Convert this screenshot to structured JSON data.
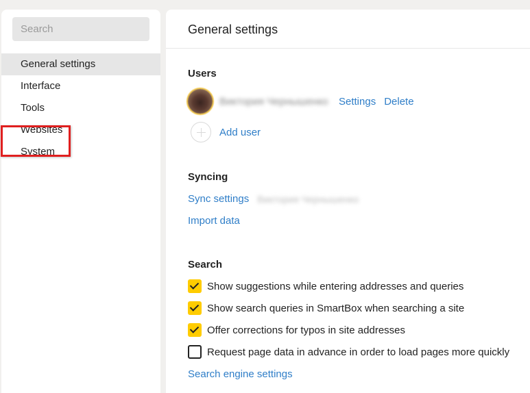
{
  "sidebar": {
    "search_placeholder": "Search",
    "items": [
      {
        "label": "General settings",
        "active": true
      },
      {
        "label": "Interface",
        "active": false
      },
      {
        "label": "Tools",
        "active": false
      },
      {
        "label": "Websites",
        "active": false
      },
      {
        "label": "System",
        "active": false
      }
    ],
    "highlighted_item": "System",
    "highlight_color": "#e01f1f"
  },
  "main": {
    "title": "General settings",
    "users": {
      "heading": "Users",
      "user_name": "Виктория Чернышенко",
      "settings_link": "Settings",
      "delete_link": "Delete",
      "add_user_link": "Add user"
    },
    "syncing": {
      "heading": "Syncing",
      "sync_settings_link": "Sync settings",
      "sync_account": "Виктория Чернышенко",
      "import_data_link": "Import data"
    },
    "search": {
      "heading": "Search",
      "options": [
        {
          "label": "Show suggestions while entering addresses and queries",
          "checked": true
        },
        {
          "label": "Show search queries in SmartBox when searching a site",
          "checked": true
        },
        {
          "label": "Offer corrections for typos in site addresses",
          "checked": true
        },
        {
          "label": "Request page data in advance in order to load pages more quickly",
          "checked": false
        }
      ],
      "engine_settings_link": "Search engine settings"
    }
  },
  "colors": {
    "link": "#2f7ec8",
    "checkbox_checked": "#ffcc00",
    "active_item_bg": "#e6e6e6",
    "page_bg": "#f1f0ee"
  }
}
